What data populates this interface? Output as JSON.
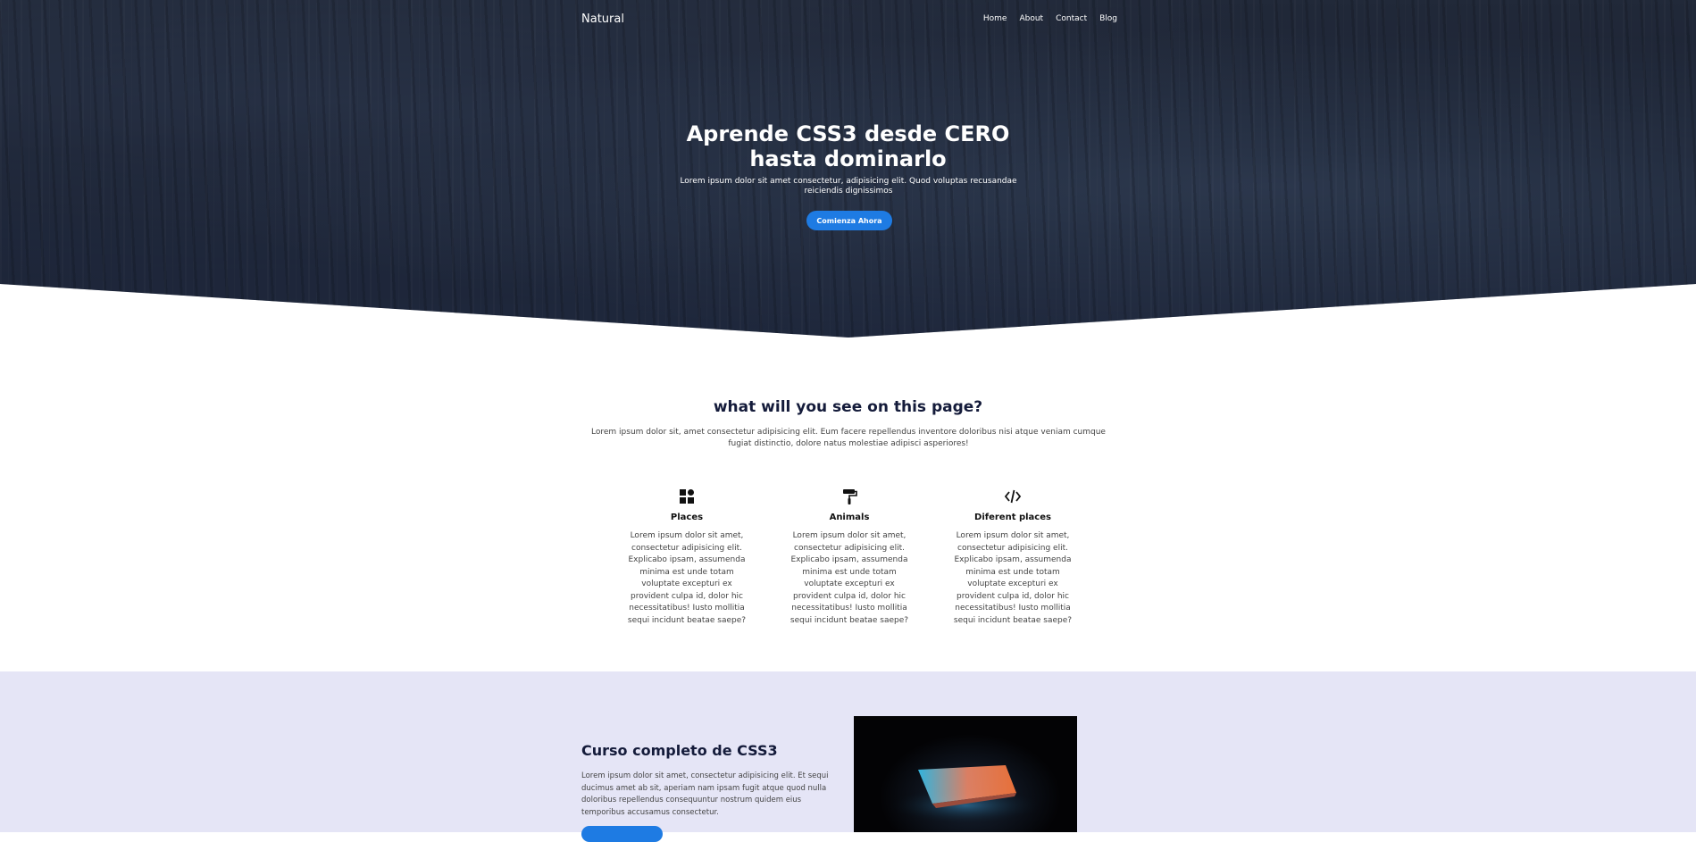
{
  "nav": {
    "logo": "Natural",
    "items": [
      "Home",
      "About",
      "Contact",
      "Blog"
    ]
  },
  "hero": {
    "title_line1": "Aprende CSS3 desde CERO",
    "title_line2": "hasta dominarlo",
    "subtitle": "Lorem ipsum dolor sit amet consectetur, adipisicing elit. Quod voluptas recusandae reiciendis dignissimos",
    "cta_label": "Comienza Ahora"
  },
  "features": {
    "title": "what will you see on this page?",
    "text": "Lorem ipsum dolor sit, amet consectetur adipisicing elit. Eum facere repellendus inventore doloribus nisi atque veniam cumque fugiat distinctio, dolore natus molestiae adipisci asperiores!",
    "cards": [
      {
        "icon": "grid-icon",
        "title": "Places",
        "text": "Lorem ipsum dolor sit amet, consectetur adipisicing elit. Explicabo ipsam, assumenda minima est unde totam voluptate excepturi ex provident culpa id, dolor hic necessitatibus! Iusto mollitia sequi incidunt beatae saepe?"
      },
      {
        "icon": "paint-roller-icon",
        "title": "Animals",
        "text": "Lorem ipsum dolor sit amet, consectetur adipisicing elit. Explicabo ipsam, assumenda minima est unde totam voluptate excepturi ex provident culpa id, dolor hic necessitatibus! Iusto mollitia sequi incidunt beatae saepe?"
      },
      {
        "icon": "code-icon",
        "title": "Diferent places",
        "text": "Lorem ipsum dolor sit amet, consectetur adipisicing elit. Explicabo ipsam, assumenda minima est unde totam voluptate excepturi ex provident culpa id, dolor hic necessitatibus! Iusto mollitia sequi incidunt beatae saepe?"
      }
    ]
  },
  "course": {
    "title": "Curso completo de CSS3",
    "text": "Lorem ipsum dolor sit amet, consectetur adipisicing elit. Et sequi ducimus amet ab sit, aperiam nam ipsam fugit atque quod nulla doloribus repellendus consequuntur nostrum quidem eius temporibus accusamus consectetur."
  },
  "colors": {
    "accent": "#1e7be3",
    "band": "#e5e5f6",
    "heading": "#141b3a"
  }
}
